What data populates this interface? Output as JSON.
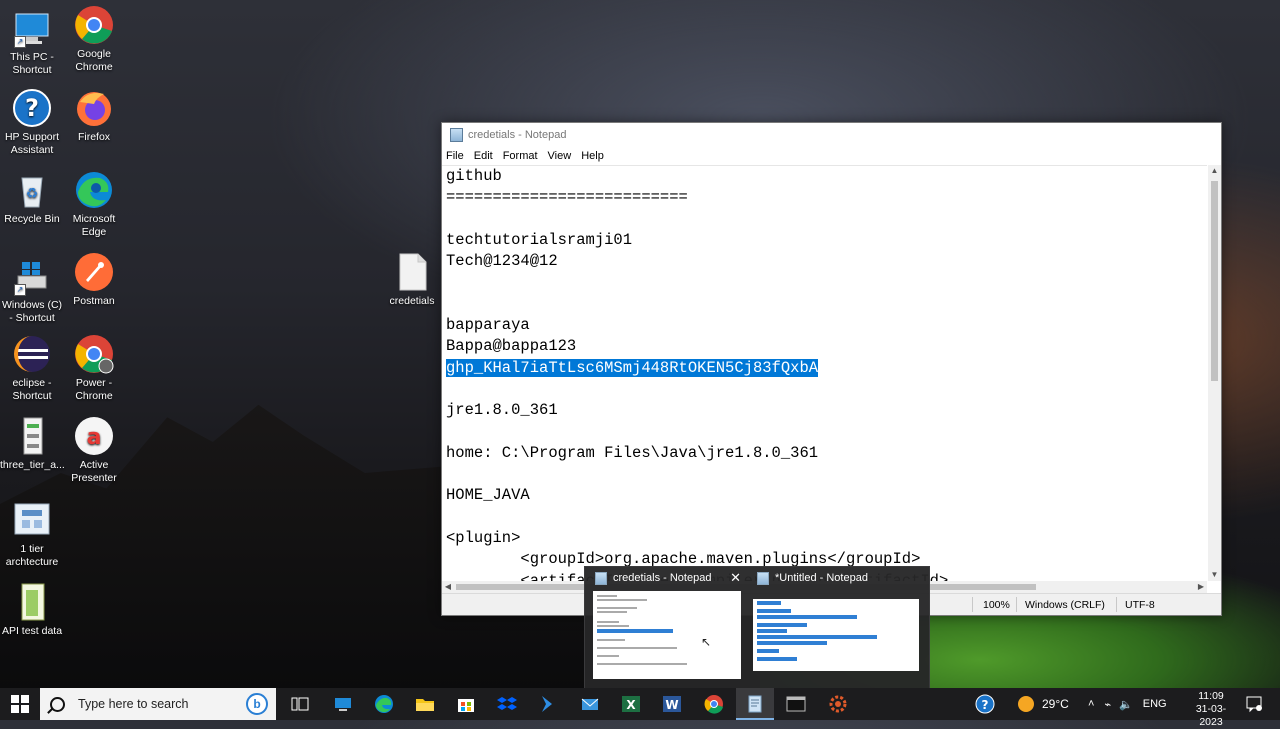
{
  "desktop": {
    "icons": [
      {
        "label": "This PC - Shortcut"
      },
      {
        "label": "Google Chrome"
      },
      {
        "label": "HP Support Assistant"
      },
      {
        "label": "Firefox"
      },
      {
        "label": "Recycle Bin"
      },
      {
        "label": "Microsoft Edge"
      },
      {
        "label": "Windows (C) - Shortcut"
      },
      {
        "label": "Postman"
      },
      {
        "label": "eclipse - Shortcut"
      },
      {
        "label": "Power - Chrome"
      },
      {
        "label": "three_tier_a..."
      },
      {
        "label": "Active Presenter"
      },
      {
        "label": "1 tier archtecture"
      },
      {
        "label": "API test data"
      },
      {
        "label": "credetials"
      }
    ]
  },
  "notepad": {
    "title": "credetials - Notepad",
    "menu": [
      "File",
      "Edit",
      "Format",
      "View",
      "Help"
    ],
    "lines": [
      "github",
      "==========================",
      "",
      "techtutorialsramji01",
      "Tech@1234@12",
      "",
      "",
      "bapparaya",
      "Bappa@bappa123",
      "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",
      "",
      "jre1.8.0_361",
      "",
      "home: C:\\Program Files\\Java\\jre1.8.0_361",
      "",
      "HOME_JAVA",
      "",
      "<plugin>",
      "        <groupId>org.apache.maven.plugins</groupId>",
      "        <artifactId>maven-compiler-plugin</artifactId>"
    ],
    "selected_line_index": 9,
    "status": {
      "zoom": "100%",
      "line_ending": "Windows (CRLF)",
      "encoding": "UTF-8"
    }
  },
  "preview": {
    "cards": [
      {
        "title": "credetials - Notepad"
      },
      {
        "title": "*Untitled - Notepad"
      }
    ]
  },
  "taskbar": {
    "search_placeholder": "Type here to search",
    "weather": "29°C",
    "language": "ENG",
    "time": "11:09",
    "date": "31-03-2023"
  }
}
